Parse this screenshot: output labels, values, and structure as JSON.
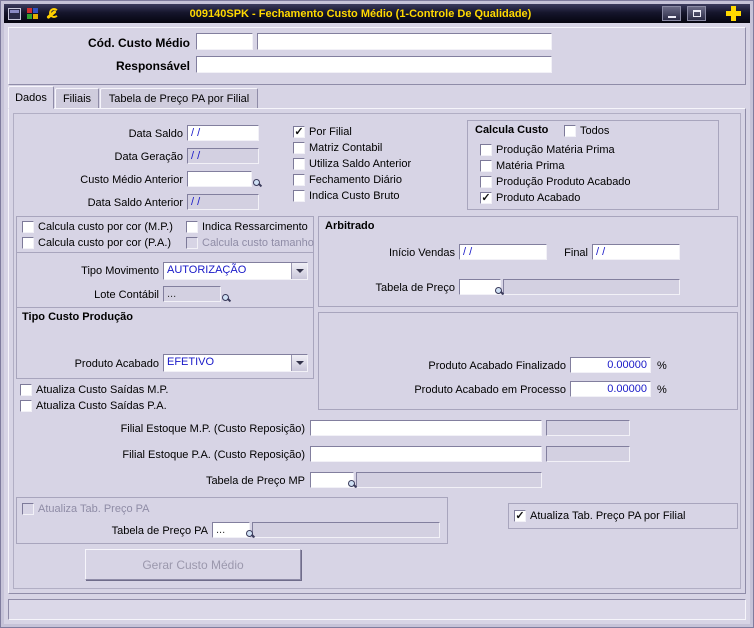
{
  "window": {
    "title": "009140SPK - Fechamento Custo Médio (1-Controle De Qualidade)"
  },
  "icons": {
    "check": "✓"
  },
  "header": {
    "cod_label": "Cód. Custo Médio",
    "cod_value": "",
    "cod_desc": "",
    "resp_label": "Responsável",
    "resp_value": ""
  },
  "tabs": [
    {
      "label": "Dados",
      "active": true
    },
    {
      "label": "Filiais",
      "active": false
    },
    {
      "label": "Tabela de Preço PA por Filial",
      "active": false
    }
  ],
  "form": {
    "data_saldo": {
      "label": "Data Saldo",
      "value": "/ /"
    },
    "data_geracao": {
      "label": "Data Geração",
      "value": "/ /"
    },
    "custo_medio_anterior": {
      "label": "Custo Médio Anterior",
      "value": ""
    },
    "data_saldo_anterior": {
      "label": "Data Saldo Anterior",
      "value": "/ /"
    },
    "calcula_custo_title": "Calcula Custo",
    "checks": {
      "por_filial": {
        "label": "Por Filial",
        "checked": true
      },
      "matriz_contabil": {
        "label": "Matriz Contabil",
        "checked": false
      },
      "utiliza_saldo_anterior": {
        "label": "Utiliza Saldo Anterior",
        "checked": false
      },
      "fechamento_diario": {
        "label": "Fechamento Diário",
        "checked": false
      },
      "indica_custo_bruto": {
        "label": "Indica Custo Bruto",
        "checked": false
      },
      "todos": {
        "label": "Todos",
        "checked": false
      },
      "producao_materia_prima": {
        "label": "Produção Matéria Prima",
        "checked": false
      },
      "materia_prima": {
        "label": "Matéria Prima",
        "checked": false
      },
      "producao_produto_acabado": {
        "label": "Produção Produto Acabado",
        "checked": false
      },
      "produto_acabado": {
        "label": "Produto Acabado",
        "checked": true
      },
      "cor_mp": {
        "label": "Calcula custo por cor (M.P.)",
        "checked": false
      },
      "indica_ressarcimento": {
        "label": "Indica Ressarcimento",
        "checked": false
      },
      "cor_pa": {
        "label": "Calcula custo por cor (P.A.)",
        "checked": false
      },
      "custo_tamanho": {
        "label": "Calcula custo tamanho",
        "checked": false
      },
      "atualiza_saidas_mp": {
        "label": "Atualiza Custo Saídas M.P.",
        "checked": false
      },
      "atualiza_saidas_pa": {
        "label": "Atualiza Custo Saídas P.A.",
        "checked": false
      },
      "atualiza_tab_pa": {
        "label": "Atualiza Tab. Preço PA",
        "checked": false
      },
      "atualiza_tab_pa_filial": {
        "label": "Atualiza Tab. Preço PA por Filial",
        "checked": true
      }
    },
    "tipo_movimento": {
      "label": "Tipo Movimento",
      "value": "AUTORIZAÇÃO"
    },
    "lote_contabil": {
      "label": "Lote Contábil",
      "value": "..."
    },
    "arbitrado": {
      "title": "Arbitrado",
      "inicio_vendas": {
        "label": "Início Vendas",
        "value": "/ /"
      },
      "final": {
        "label": "Final",
        "value": "/ /"
      },
      "tabela_preco": {
        "label": "Tabela de Preço",
        "value": "",
        "desc": ""
      }
    },
    "tipo_custo_producao": {
      "title": "Tipo Custo Produção",
      "produto_acabado": {
        "label": "Produto Acabado",
        "value": "EFETIVO"
      }
    },
    "pa_finalizado": {
      "label": "Produto Acabado Finalizado",
      "value": "0.00000",
      "unit": "%"
    },
    "pa_processo": {
      "label": "Produto Acabado em Processo",
      "value": "0.00000",
      "unit": "%"
    },
    "filial_mp": {
      "label": "Filial Estoque M.P. (Custo Reposição)",
      "value": "",
      "code": ""
    },
    "filial_pa": {
      "label": "Filial Estoque P.A. (Custo Reposição)",
      "value": "",
      "code": ""
    },
    "tabela_mp": {
      "label": "Tabela de Preço MP",
      "value": "",
      "desc": ""
    },
    "tabela_pa": {
      "label": "Tabela de Preço PA",
      "value": "...",
      "desc": ""
    },
    "gerar_button": "Gerar Custo Médio"
  }
}
